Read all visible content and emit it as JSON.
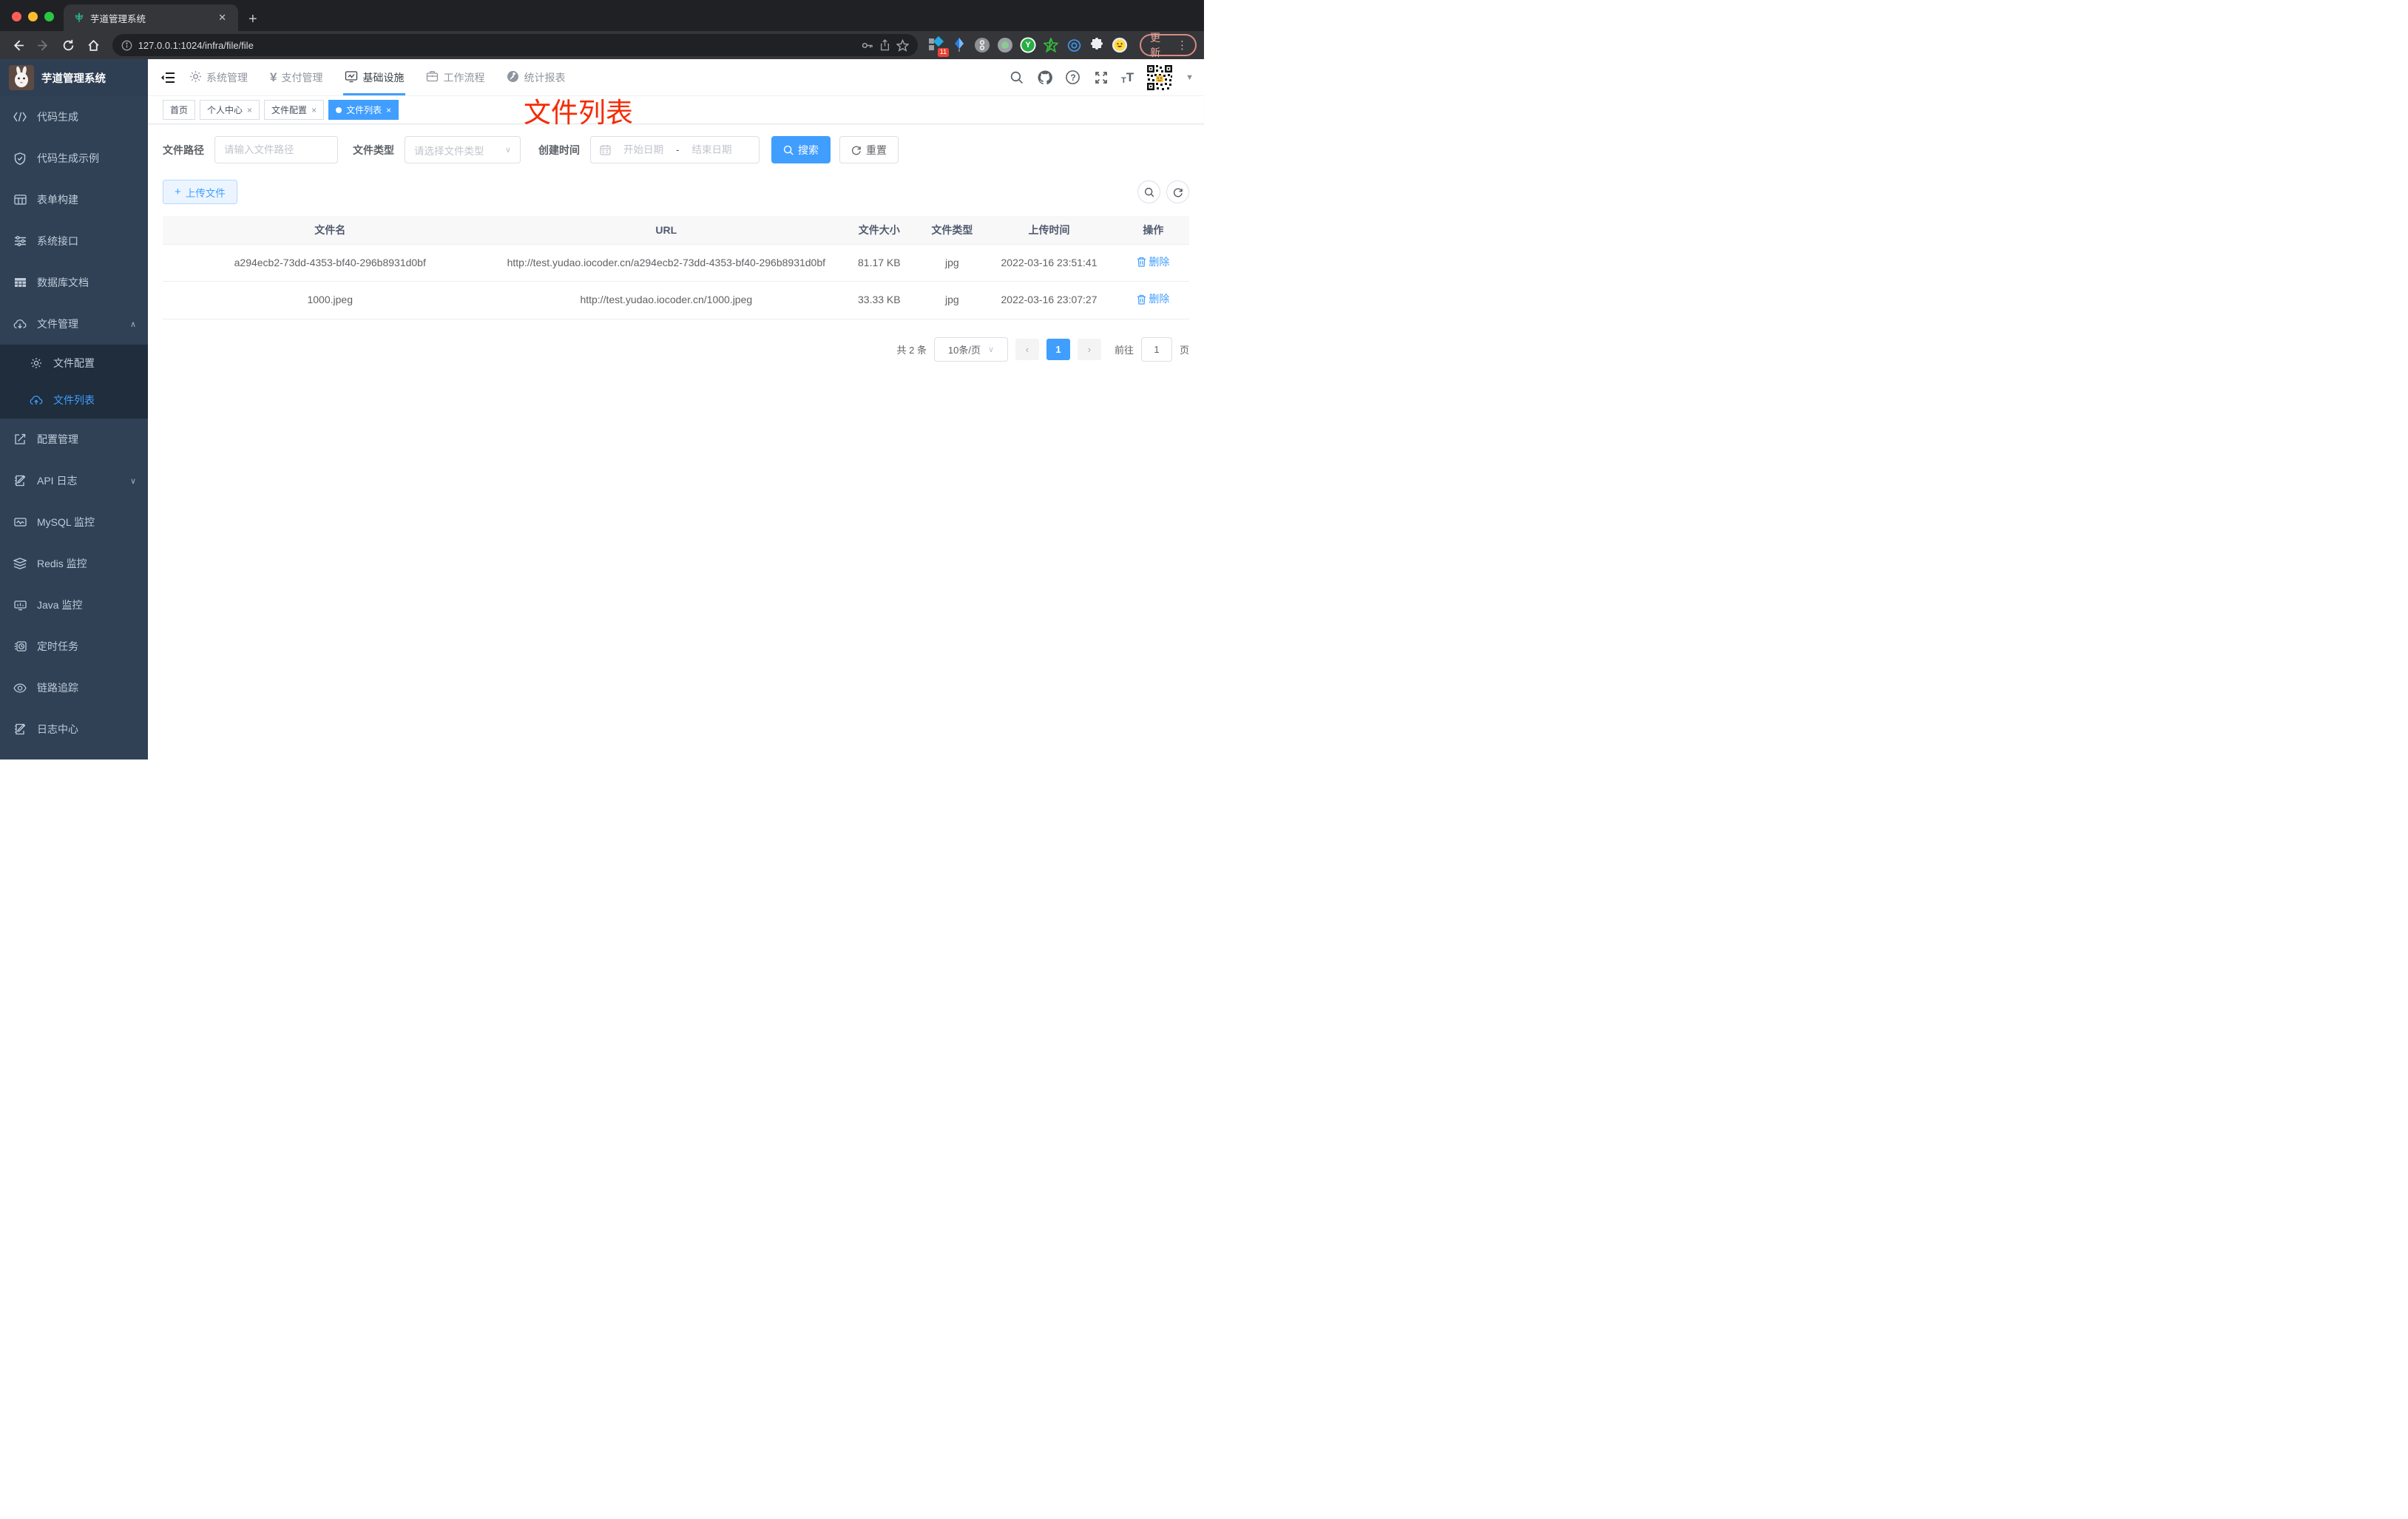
{
  "browser": {
    "tab": {
      "title": "芋道管理系统",
      "close_glyph": "✕",
      "newtab_glyph": "+"
    },
    "url": "127.0.0.1:1024/infra/file/file",
    "ext_badge": "11",
    "yudao_ext_label": "Y",
    "update_label": "更新",
    "menu_dots": "⋮"
  },
  "icons": {
    "close": "×",
    "chevron_up": "∧",
    "chevron_down": "∨",
    "caret_down": "▼",
    "yen": "¥",
    "question": "?",
    "plus": "+",
    "dash": "-",
    "prev": "‹",
    "next": "›",
    "t_small": "T",
    "t_big": "T"
  },
  "sidebar": {
    "logo_title": "芋道管理系统",
    "items": [
      {
        "label": "代码生成"
      },
      {
        "label": "代码生成示例"
      },
      {
        "label": "表单构建"
      },
      {
        "label": "系统接口"
      },
      {
        "label": "数据库文档"
      },
      {
        "label": "文件管理",
        "expanded": true,
        "children": [
          {
            "label": "文件配置"
          },
          {
            "label": "文件列表",
            "active": true
          }
        ]
      },
      {
        "label": "配置管理"
      },
      {
        "label": "API 日志",
        "collapsed": true
      },
      {
        "label": "MySQL 监控"
      },
      {
        "label": "Redis 监控"
      },
      {
        "label": "Java 监控"
      },
      {
        "label": "定时任务"
      },
      {
        "label": "链路追踪"
      },
      {
        "label": "日志中心"
      }
    ]
  },
  "nav": {
    "menu": [
      {
        "label": "系统管理"
      },
      {
        "label": "支付管理"
      },
      {
        "label": "基础设施",
        "active": true
      },
      {
        "label": "工作流程"
      },
      {
        "label": "统计报表"
      }
    ]
  },
  "tags": [
    {
      "label": "首页",
      "closable": false
    },
    {
      "label": "个人中心",
      "closable": true
    },
    {
      "label": "文件配置",
      "closable": true
    },
    {
      "label": "文件列表",
      "closable": true,
      "active": true
    }
  ],
  "annotation": "文件列表",
  "filter": {
    "path_label": "文件路径",
    "path_placeholder": "请输入文件路径",
    "type_label": "文件类型",
    "type_placeholder": "请选择文件类型",
    "date_label": "创建时间",
    "date_start_placeholder": "开始日期",
    "date_separator": "-",
    "date_end_placeholder": "结束日期",
    "search_label": "搜索",
    "reset_label": "重置"
  },
  "toolbar": {
    "upload_label": "上传文件"
  },
  "table": {
    "columns": [
      "文件名",
      "URL",
      "文件大小",
      "文件类型",
      "上传时间",
      "操作"
    ],
    "rows": [
      {
        "name": "a294ecb2-73dd-4353-bf40-296b8931d0bf",
        "url": "http://test.yudao.iocoder.cn/a294ecb2-73dd-4353-bf40-296b8931d0bf",
        "size": "81.17 KB",
        "type": "jpg",
        "time": "2022-03-16 23:51:41",
        "action": "删除"
      },
      {
        "name": "1000.jpeg",
        "url": "http://test.yudao.iocoder.cn/1000.jpeg",
        "size": "33.33 KB",
        "type": "jpg",
        "time": "2022-03-16 23:07:27",
        "action": "删除"
      }
    ]
  },
  "pagination": {
    "total": "共 2 条",
    "page_size": "10条/页",
    "current_page": "1",
    "goto_label": "前往",
    "goto_value": "1",
    "unit_label": "页"
  },
  "colors": {
    "accent": "#409eff",
    "sidebar_bg": "#304156",
    "submenu_bg": "#1f2d3d",
    "annotation_red": "#f42c05"
  }
}
